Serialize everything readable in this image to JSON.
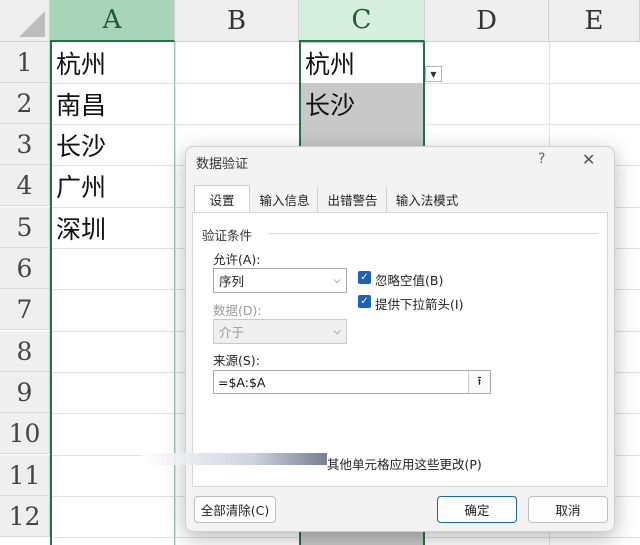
{
  "sheet": {
    "columns": [
      "A",
      "B",
      "C",
      "D",
      "E"
    ],
    "rows": [
      "1",
      "2",
      "3",
      "4",
      "5",
      "6",
      "7",
      "8",
      "9",
      "10",
      "11",
      "12"
    ],
    "columnA": [
      "杭州",
      "南昌",
      "长沙",
      "广州",
      "深圳"
    ],
    "columnC": [
      "杭州",
      "长沙"
    ]
  },
  "dialog": {
    "title": "数据验证",
    "help": "?",
    "close": "✕",
    "tabs": [
      "设置",
      "输入信息",
      "出错警告",
      "输入法模式"
    ],
    "group_label": "验证条件",
    "allow_label": "允许(A):",
    "allow_value": "序列",
    "data_label": "数据(D):",
    "data_value": "介于",
    "ignore_blank": "忽略空值(B)",
    "in_cell_dropdown": "提供下拉箭头(I)",
    "source_label": "来源(S):",
    "source_value": "=$A:$A",
    "apply_text": "其他单元格应用这些更改(P)",
    "clear_all": "全部清除(C)",
    "ok": "确定",
    "cancel": "取消"
  },
  "colors": {
    "accent": "#217346",
    "checkbox": "#1a63b8",
    "selection_fill": "#c8c8c8"
  }
}
